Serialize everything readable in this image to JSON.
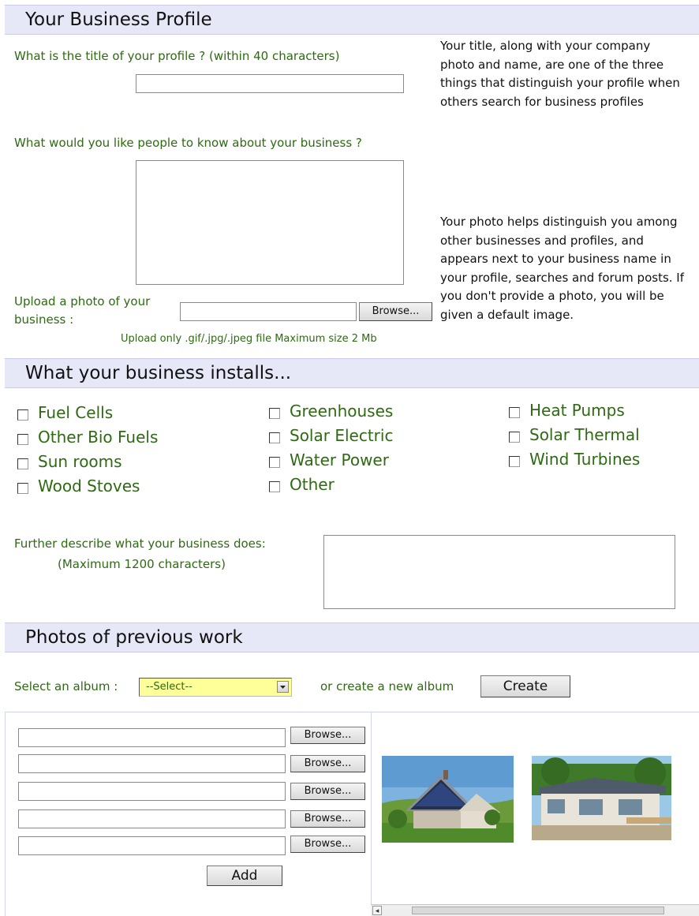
{
  "profile_section": {
    "title": "Your Business Profile",
    "title_question": "What is the title of your profile ? (within 40 characters)",
    "title_value": "",
    "about_question": "What would you like people to know about your business ?",
    "about_value": "",
    "title_help": "Your title, along with your company photo and name, are one of the three things that distinguish your profile when others search for business profiles",
    "photo_help": "Your photo helps distinguish you among other businesses and profiles, and appears next to your business name in your profile, searches and forum posts.  If you don't provide a photo, you will be given a default image.",
    "upload_label": "Upload a photo of your business :",
    "upload_value": "",
    "browse_label": "Browse...",
    "upload_note": "Upload only .gif/.jpg/.jpeg  file Maximum size 2 Mb"
  },
  "installs_section": {
    "title": "What your business installs...",
    "col1": [
      {
        "label": "Fuel Cells",
        "checked": false
      },
      {
        "label": "Other Bio Fuels",
        "checked": false
      },
      {
        "label": "Sun rooms",
        "checked": false
      },
      {
        "label": "Wood Stoves",
        "checked": false
      }
    ],
    "col2": [
      {
        "label": "Greenhouses",
        "checked": false
      },
      {
        "label": "Solar Electric",
        "checked": false
      },
      {
        "label": "Water Power",
        "checked": false
      },
      {
        "label": "Other",
        "checked": false
      }
    ],
    "col3": [
      {
        "label": "Heat Pumps",
        "checked": false
      },
      {
        "label": "Solar Thermal",
        "checked": false
      },
      {
        "label": "Wind Turbines",
        "checked": false
      }
    ],
    "describe_label": "Further describe what your business does:",
    "describe_note": "(Maximum 1200 characters)",
    "describe_value": ""
  },
  "photos_section": {
    "title": "Photos of previous work",
    "album_label": "Select an album :",
    "album_selected": "--Select--",
    "or_create_label": "or create a new album",
    "create_button": "Create",
    "file_rows": [
      "Browse...",
      "Browse...",
      "Browse...",
      "Browse...",
      "Browse..."
    ],
    "add_button": "Add",
    "thumbnails": [
      "house-solar-roof-photo",
      "house-solar-panels-photo"
    ],
    "scroll_left_glyph": "◂"
  },
  "colors": {
    "section_band": "#e6e7f7",
    "label_green": "#2e6a12",
    "select_yellow": "#ffff99"
  }
}
